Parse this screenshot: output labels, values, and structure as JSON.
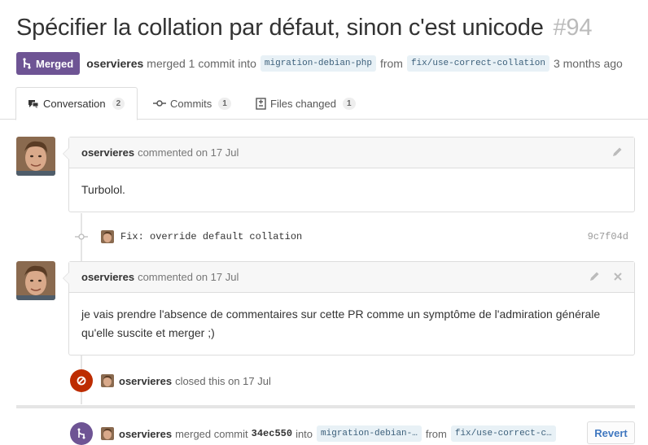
{
  "pr": {
    "title": "Spécifier la collation par défaut, sinon c'est unicode",
    "number": "#94",
    "status": "Merged",
    "author": "oservieres",
    "merged_text": "merged 1 commit into",
    "base_branch": "migration-debian-php",
    "from_text": "from",
    "head_branch": "fix/use-correct-collation",
    "time_ago": "3 months ago"
  },
  "tabs": [
    {
      "label": "Conversation",
      "count": "2",
      "icon": "comment-discussion-icon"
    },
    {
      "label": "Commits",
      "count": "1",
      "icon": "git-commit-icon"
    },
    {
      "label": "Files changed",
      "count": "1",
      "icon": "diff-icon"
    }
  ],
  "comments": [
    {
      "author": "oservieres",
      "meta": "commented on 17 Jul",
      "body": "Turbolol."
    },
    {
      "author": "oservieres",
      "meta": "commented on 17 Jul",
      "body": "je vais prendre l'absence de commentaires sur cette PR comme un symptôme de l'admiration générale qu'elle suscite et merger ;)"
    }
  ],
  "commit": {
    "message": "Fix: override default collation",
    "sha": "9c7f04d"
  },
  "closed_event": {
    "author": "oservieres",
    "text": "closed this on 17 Jul"
  },
  "merge_event": {
    "author": "oservieres",
    "text": "merged commit",
    "sha": "34ec550",
    "into_text": "into",
    "base_branch": "migration-debian-…",
    "from_text": "from",
    "head_branch": "fix/use-correct-c…",
    "revert_label": "Revert"
  },
  "colors": {
    "merged": "#6e5494",
    "closed": "#bd2c00",
    "link": "#4078c0"
  }
}
